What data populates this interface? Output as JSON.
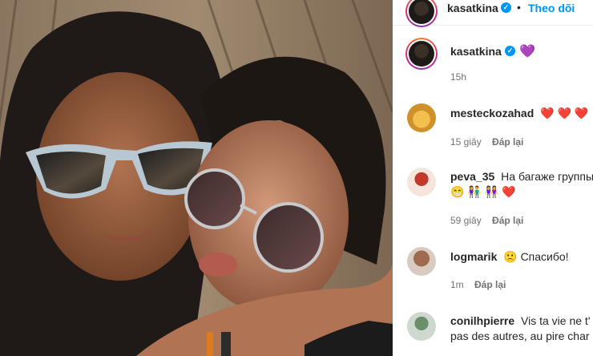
{
  "post": {
    "author": "kasatkina",
    "follow_label": "Theo dõi",
    "separator": "•"
  },
  "caption": {
    "username": "kasatkina",
    "heart": "💜",
    "time": "15h"
  },
  "comments": [
    {
      "username": "mesteckozahad",
      "text": "❤️ ❤️ ❤️ 🏴",
      "time": "15 giây",
      "reply_label": "Đáp lại"
    },
    {
      "username": "peva_35",
      "text": "На багаже группы",
      "text2": "😁 👫 👭 ❤️",
      "time": "59 giây",
      "reply_label": "Đáp lại"
    },
    {
      "username": "logmarik",
      "text": "🙁 Спасибо!",
      "time": "1m",
      "reply_label": "Đáp lại"
    },
    {
      "username": "conilhpierre",
      "text": "Vis ta vie ne t'",
      "text2": "pas des autres, au pire char"
    }
  ],
  "colors": {
    "link": "#0095f6",
    "muted": "#737373",
    "text": "#262626"
  }
}
